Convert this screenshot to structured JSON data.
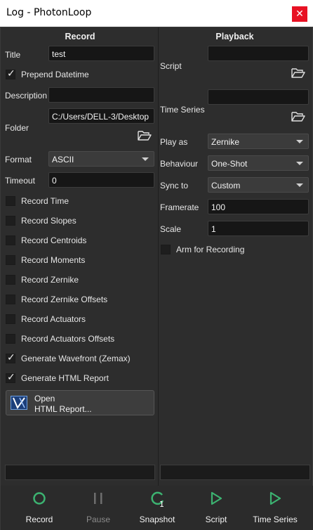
{
  "window": {
    "title": "Log - PhotonLoop",
    "close_glyph": "✕"
  },
  "record": {
    "header": "Record",
    "title_label": "Title",
    "title_value": "test",
    "prepend_datetime": {
      "label": "Prepend Datetime",
      "checked": true
    },
    "description_label": "Description",
    "description_value": "",
    "folder_label": "Folder",
    "folder_value": "C:/Users/DELL-3/Desktop",
    "format_label": "Format",
    "format_value": "ASCII",
    "timeout_label": "Timeout",
    "timeout_value": "0",
    "options": [
      {
        "label": "Record Time",
        "checked": false
      },
      {
        "label": "Record Slopes",
        "checked": false
      },
      {
        "label": "Record Centroids",
        "checked": false
      },
      {
        "label": "Record Moments",
        "checked": false
      },
      {
        "label": "Record Zernike",
        "checked": false
      },
      {
        "label": "Record Zernike Offsets",
        "checked": false
      },
      {
        "label": "Record Actuators",
        "checked": false
      },
      {
        "label": "Record Actuators Offsets",
        "checked": false
      },
      {
        "label": "Generate Wavefront (Zemax)",
        "checked": true
      },
      {
        "label": "Generate HTML Report",
        "checked": true
      }
    ],
    "open_report": {
      "line1": "Open",
      "line2": "HTML Report..."
    }
  },
  "playback": {
    "header": "Playback",
    "script_label": "Script",
    "script_value": "",
    "time_series_label": "Time Series",
    "time_series_value": "",
    "play_as_label": "Play as",
    "play_as_value": "Zernike",
    "behaviour_label": "Behaviour",
    "behaviour_value": "One-Shot",
    "sync_to_label": "Sync to",
    "sync_to_value": "Custom",
    "framerate_label": "Framerate",
    "framerate_value": "100",
    "scale_label": "Scale",
    "scale_value": "1",
    "arm_for_recording": {
      "label": "Arm for Recording",
      "checked": false
    }
  },
  "toolbar": {
    "record": "Record",
    "pause": "Pause",
    "snapshot": "Snapshot",
    "snapshot_badge": "1",
    "script": "Script",
    "time_series": "Time Series"
  },
  "colors": {
    "accent_green": "#3cb371",
    "disabled_gray": "#6e6e6e",
    "close_red": "#e81123",
    "folder_icon": "#e0e0e0"
  }
}
